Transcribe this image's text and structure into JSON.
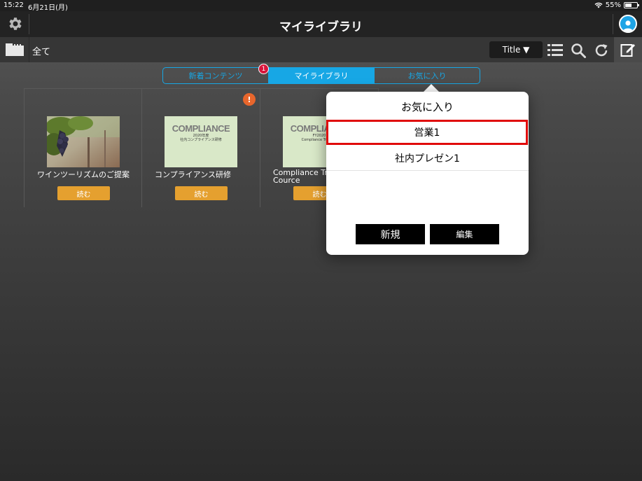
{
  "status_bar": {
    "time": "15:22",
    "date": "6月21日(月)",
    "battery": "55%"
  },
  "nav": {
    "title": "マイライブラリ"
  },
  "toolbar": {
    "folder_label": "全て",
    "sort_label": "Title ▼"
  },
  "tabs": [
    {
      "label": "新着コンテンツ",
      "badge": "1"
    },
    {
      "label": "マイライブラリ",
      "active": true
    },
    {
      "label": "お気に入り"
    }
  ],
  "cards": [
    {
      "title": "ワインツーリズムのご提案",
      "read_label": "読む"
    },
    {
      "title": "コンプライアンス研修",
      "read_label": "読む",
      "alert": "!",
      "thumb": {
        "heading": "COMPLIANCE",
        "line1": "2020年度",
        "line2": "社内コンプライアンス研修"
      }
    },
    {
      "title": "Compliance Training Cource",
      "title_line1": "Compliance Tra",
      "title_line2": "Cource",
      "read_label": "読む",
      "thumb": {
        "heading": "COMPLIANCE",
        "line1": "FY2020",
        "line2": "Compliance Training"
      }
    }
  ],
  "popover": {
    "title": "お気に入り",
    "items": [
      "営業1",
      "社内プレゼン1"
    ],
    "new_label": "新規",
    "edit_label": "編集"
  },
  "colors": {
    "accent": "#17a7e5",
    "read_button": "#e5a02f",
    "highlight": "#e00a0a",
    "badge": "#d8143a",
    "alert": "#e8662c"
  }
}
